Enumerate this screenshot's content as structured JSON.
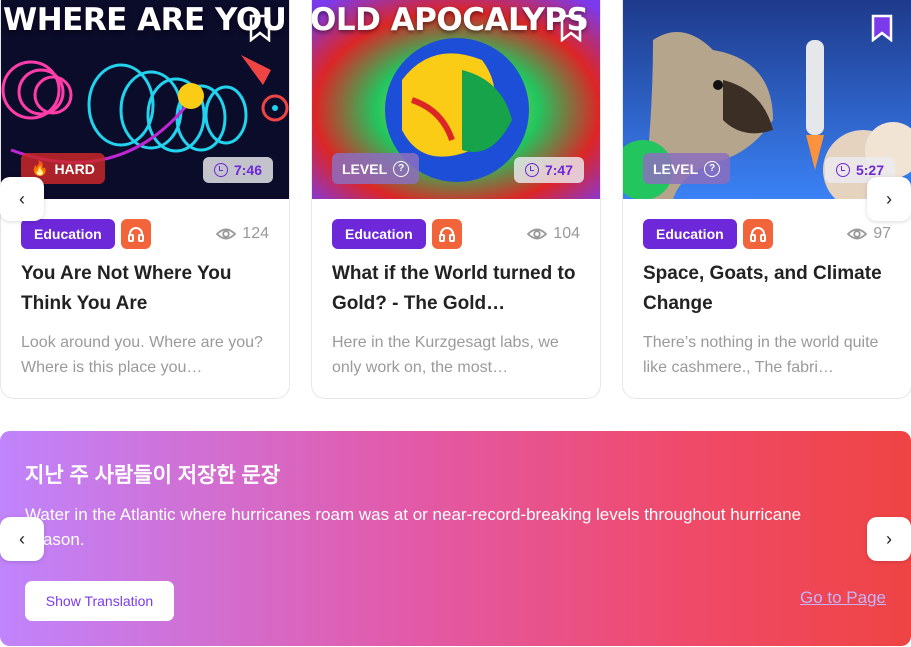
{
  "cards": [
    {
      "thumb_text": "WHERE ARE YOU",
      "badge": "HARD",
      "badge_emoji": "🔥",
      "duration": "7:46",
      "category": "Education",
      "views": "124",
      "title": "You Are Not Where You Think You Are",
      "description": "Look around you. Where are you? Where is this place you…",
      "bookmarked": false
    },
    {
      "thumb_text": "OLD APOCALYPS",
      "badge": "LEVEL",
      "duration": "7:47",
      "category": "Education",
      "views": "104",
      "title": "What if the World turned to Gold? - The Gold…",
      "description": "Here in the Kurzgesagt labs, we only work on, the most…",
      "bookmarked": false
    },
    {
      "thumb_text": "",
      "badge": "LEVEL",
      "duration": "5:27",
      "category": "Education",
      "views": "97",
      "title": "Space, Goats, and Climate Change",
      "description": "There’s nothing in the world quite like cashmere., The fabri…",
      "bookmarked": true
    }
  ],
  "banner": {
    "heading": "지난 주 사람들이 저장한 문장",
    "sentence": "Water in the Atlantic where hurricanes roam was at or near-record-breaking levels throughout hurricane season.",
    "show_translation": "Show Translation",
    "go_to_page": "Go to Page"
  },
  "colors": {
    "accent": "#6d28d9",
    "audio": "#f2643a",
    "bookmark_active": "#7c3aed"
  },
  "nav": {
    "prev_glyph": "‹",
    "next_glyph": "›"
  }
}
